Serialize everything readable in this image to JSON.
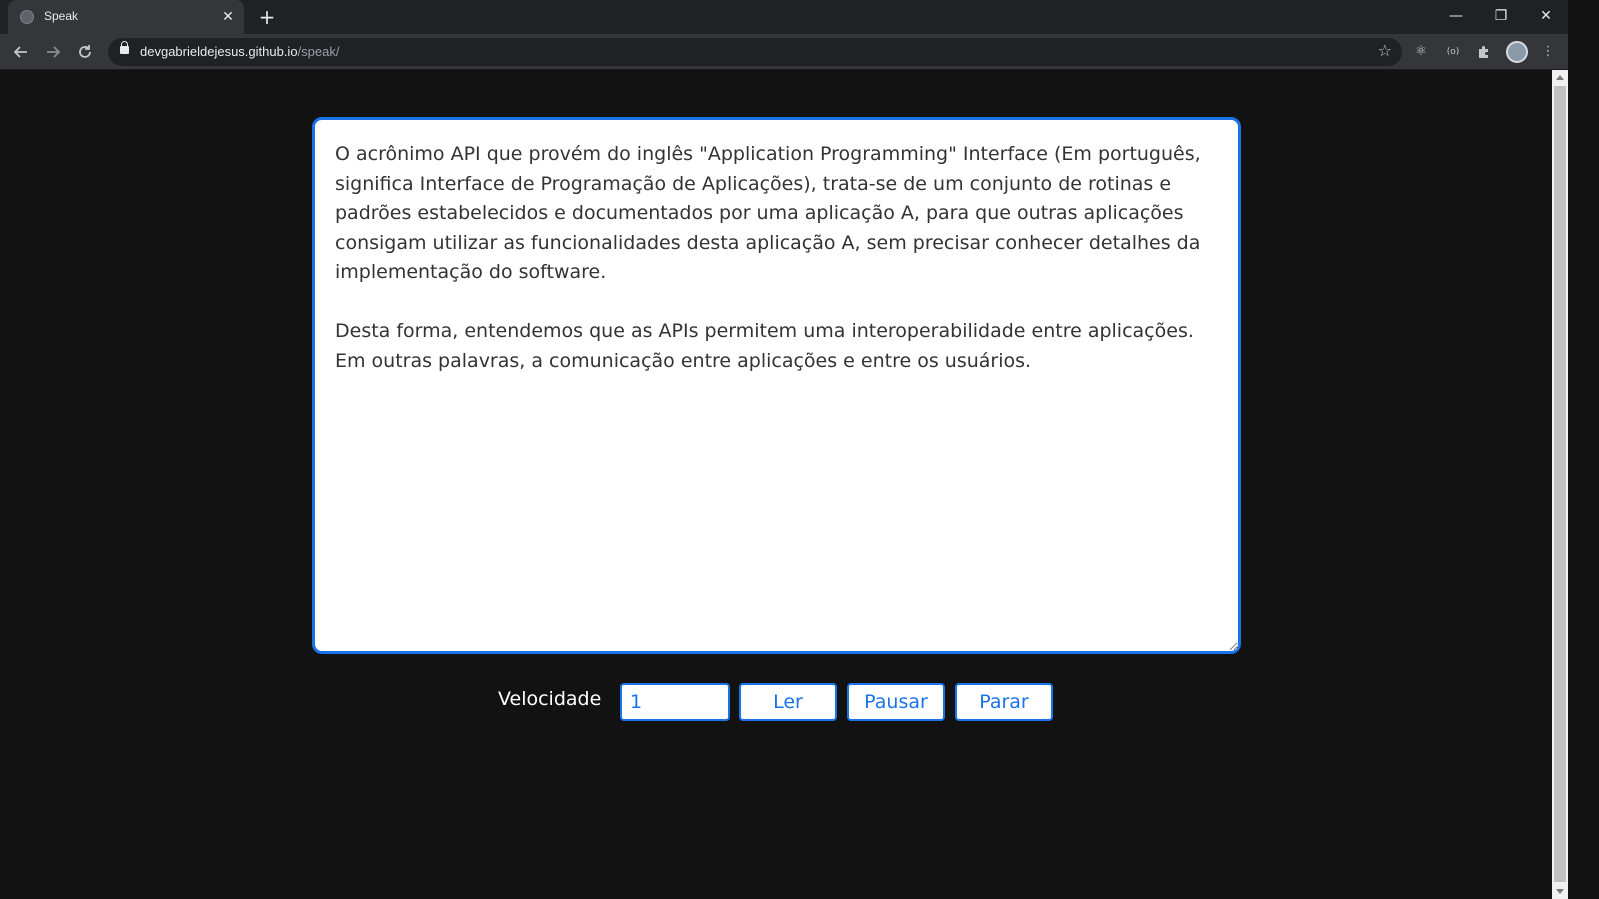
{
  "browser": {
    "tab_title": "Speak",
    "tab_close": "✕",
    "new_tab": "+",
    "url_host": "devgabrieldejesus.github.io",
    "url_path": "/speak/",
    "window_controls": {
      "minimize": "—",
      "restore": "❐",
      "close": "✕"
    }
  },
  "editor": {
    "text": "O acrônimo API que provém do inglês \"Application Programming\" Interface (Em português, significa Interface de Programação de Aplicações), trata-se de um conjunto de rotinas e padrões estabelecidos e documentados por uma aplicação A, para que outras aplicações consigam utilizar as funcionalidades desta aplicação A, sem precisar conhecer detalhes da implementação do software.\n\nDesta forma, entendemos que as APIs permitem uma interoperabilidade entre aplicações. Em outras palavras, a comunicação entre aplicações e entre os usuários."
  },
  "controls": {
    "speed_label": "Velocidade",
    "speed_value": "1",
    "read_label": "Ler",
    "pause_label": "Pausar",
    "stop_label": "Parar"
  },
  "colors": {
    "accent": "#1a73e8",
    "page_background": "#121212",
    "text": "#333333"
  }
}
